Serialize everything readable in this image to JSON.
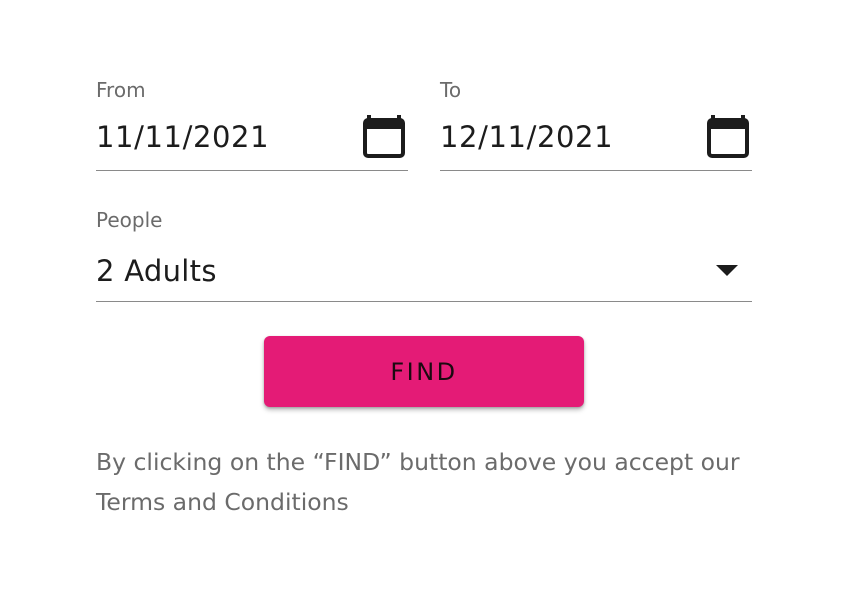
{
  "search_form": {
    "from": {
      "label": "From",
      "value": "11/11/2021",
      "icon": "calendar-icon"
    },
    "to": {
      "label": "To",
      "value": "12/11/2021",
      "icon": "calendar-icon"
    },
    "people": {
      "label": "People",
      "value": "2 Adults",
      "icon": "dropdown-arrow-icon"
    },
    "find_button": {
      "label": "FIND",
      "color": "#e41b76"
    },
    "disclaimer": "By clicking on the “FIND” button above you accept our Terms and Conditions"
  }
}
